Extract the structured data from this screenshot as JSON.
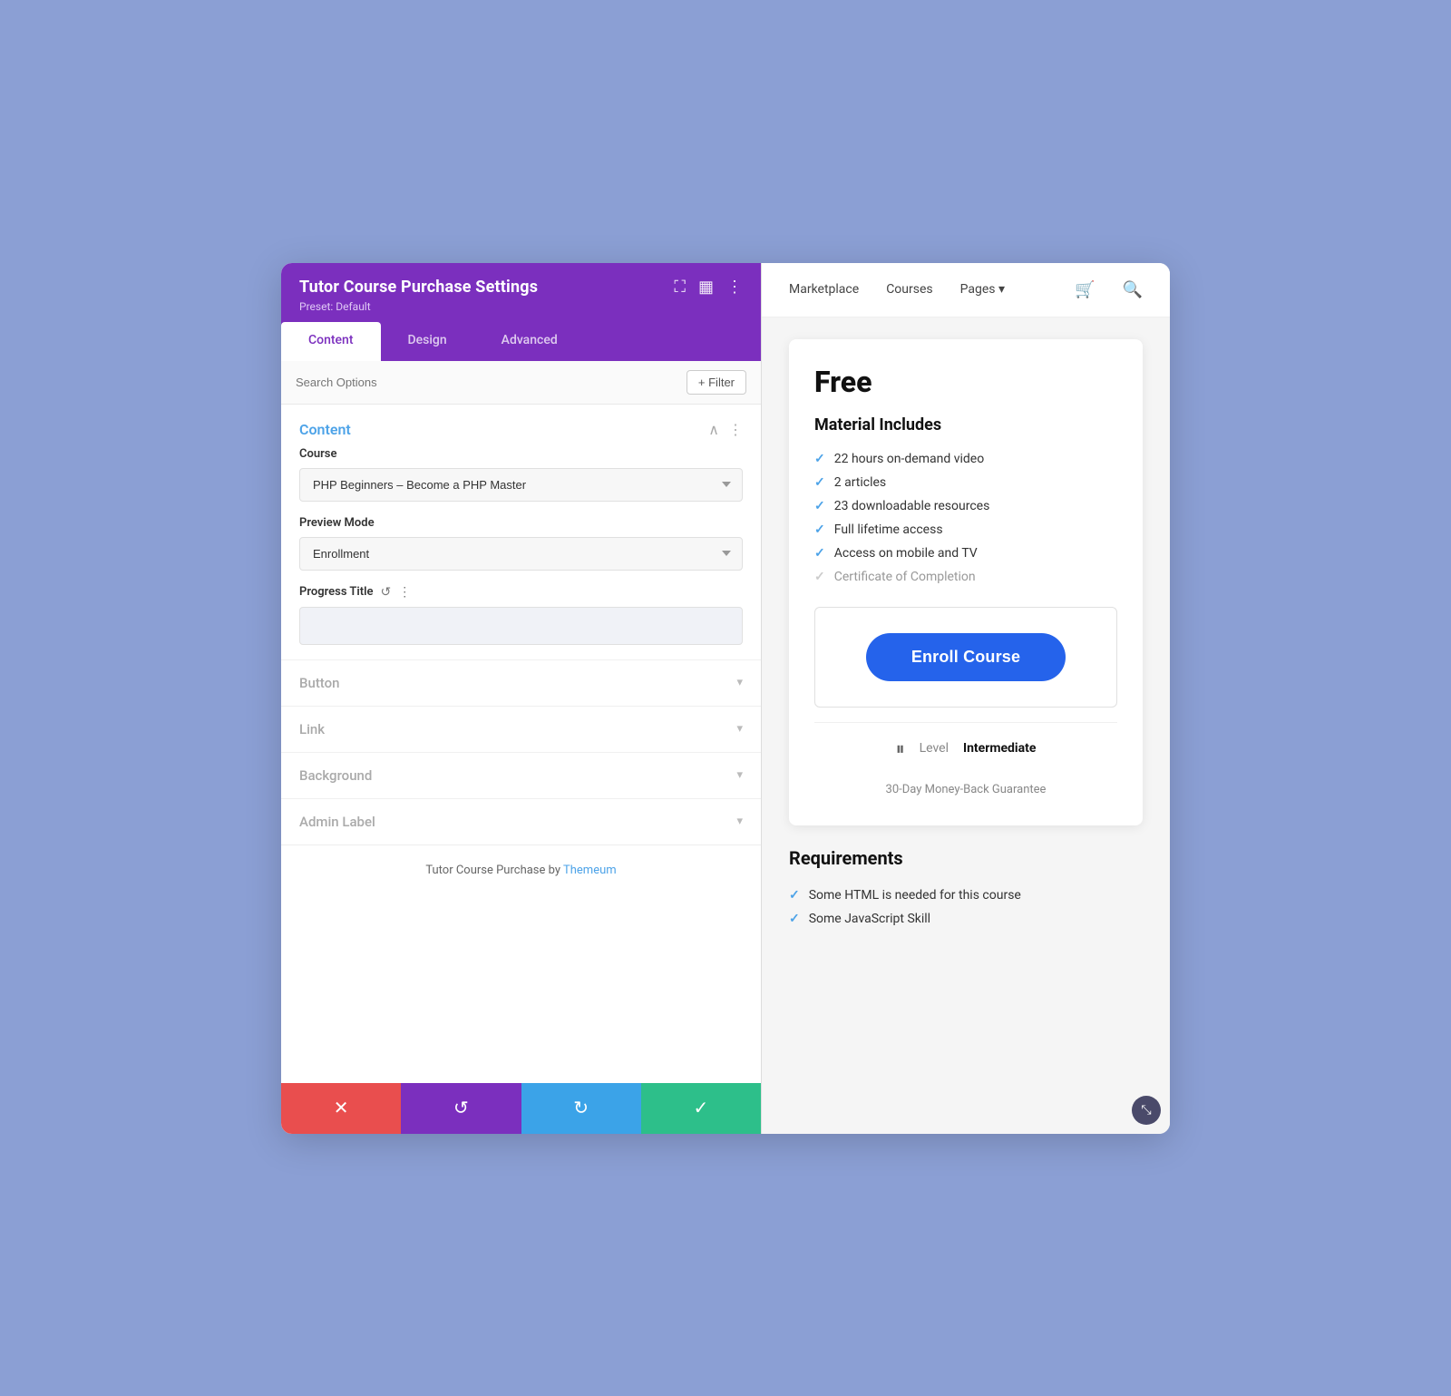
{
  "app": {
    "title": "Tutor Course Purchase Settings",
    "preset": "Preset: Default",
    "background_color": "#8b9fd4"
  },
  "tabs": [
    {
      "label": "Content",
      "active": true
    },
    {
      "label": "Design",
      "active": false
    },
    {
      "label": "Advanced",
      "active": false
    }
  ],
  "search": {
    "placeholder": "Search Options",
    "filter_label": "+ Filter"
  },
  "content_section": {
    "title": "Content",
    "course_label": "Course",
    "course_value": "PHP Beginners – Become a PHP Master",
    "preview_mode_label": "Preview Mode",
    "preview_mode_value": "Enrollment",
    "progress_title_label": "Progress Title",
    "progress_title_value": ""
  },
  "collapsible_sections": [
    {
      "label": "Button"
    },
    {
      "label": "Link"
    },
    {
      "label": "Background"
    },
    {
      "label": "Admin Label"
    }
  ],
  "footer": {
    "credit_text": "Tutor Course Purchase by ",
    "credit_link": "Themeum",
    "credit_link_url": "#"
  },
  "action_bar": {
    "cancel_icon": "✕",
    "undo_icon": "↺",
    "redo_icon": "↻",
    "save_icon": "✓"
  },
  "nav": {
    "items": [
      {
        "label": "Marketplace",
        "active": false
      },
      {
        "label": "Courses",
        "active": false
      },
      {
        "label": "Pages ▾",
        "active": false
      }
    ],
    "cart_icon": "🛒",
    "search_icon": "🔍"
  },
  "course_widget": {
    "price": "Free",
    "material_title": "Material Includes",
    "features": [
      "22 hours on-demand video",
      "2 articles",
      "23 downloadable resources",
      "Full lifetime access",
      "Access on mobile and TV",
      "Certificate of Completion"
    ],
    "enroll_button": "Enroll Course",
    "level_label": "Level",
    "level_value": "Intermediate",
    "money_back": "30-Day Money-Back Guarantee"
  },
  "requirements": {
    "title": "Requirements",
    "items": [
      "Some HTML is needed for this course",
      "Some JavaScript Skill"
    ]
  }
}
